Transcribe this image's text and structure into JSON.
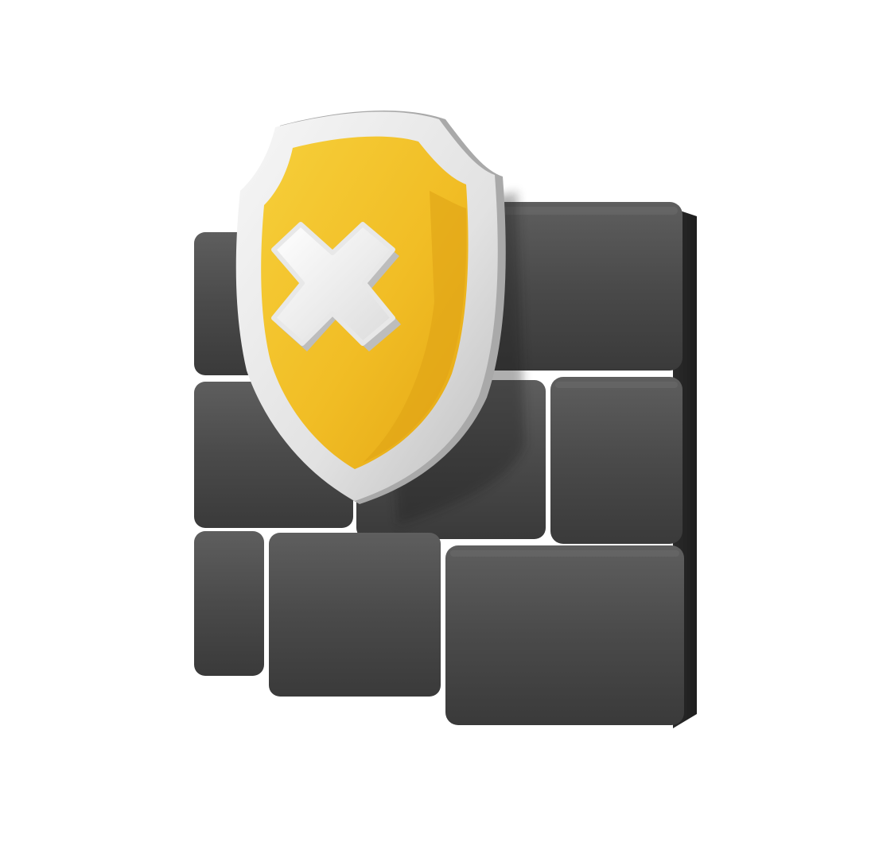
{
  "illustration": {
    "subject": "firewall-icon",
    "icons": {
      "wall": "brick-wall-icon",
      "shield": "shield-icon",
      "mark": "x-mark-icon"
    },
    "colors": {
      "background": "#ffffff",
      "brick_face": "#4a4a4a",
      "brick_face_light": "#5c5c5c",
      "brick_side": "#2b2b2b",
      "shield_rim": "#e9e9e9",
      "shield_rim_shadow": "#b5b5b5",
      "shield_fill": "#f3c22e",
      "shield_fill_dark": "#e3a716",
      "mark_color": "#f5f5f5"
    }
  }
}
